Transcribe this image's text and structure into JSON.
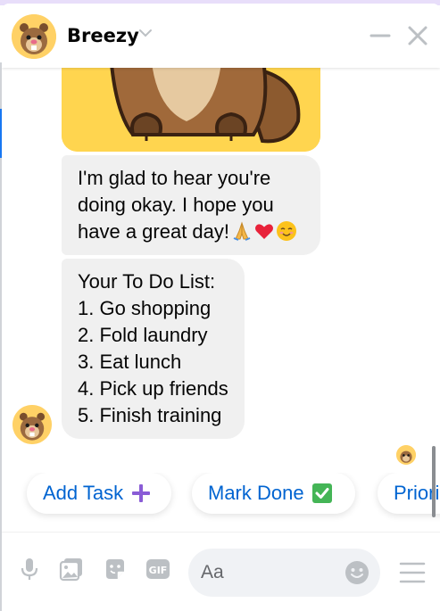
{
  "header": {
    "name": "Breezy"
  },
  "messages": {
    "bubble_1_lines": [
      "I'm glad to hear you're",
      "doing okay. I hope you",
      "have a great day!"
    ],
    "bubble_1_emojis": [
      "folded-hands",
      "red-heart",
      "smiling-face"
    ],
    "todo_lines": [
      "Your To Do List:",
      "1. Go shopping",
      "2. Fold laundry",
      "3. Eat lunch",
      "4. Pick up friends",
      "5. Finish training"
    ]
  },
  "quick_replies": [
    {
      "label": "Add Task",
      "icon": "plus-icon"
    },
    {
      "label": "Mark Done",
      "icon": "check-box-icon"
    },
    {
      "label": "Priori"
    }
  ],
  "composer": {
    "placeholder": "Aa",
    "gif_label": "GIF"
  },
  "colors": {
    "link": "#0064d1",
    "bubble": "#f0f0f0",
    "accent_purple": "#8a5cd6",
    "check_green": "#44b556",
    "sticker_yellow": "#ffd54f"
  }
}
